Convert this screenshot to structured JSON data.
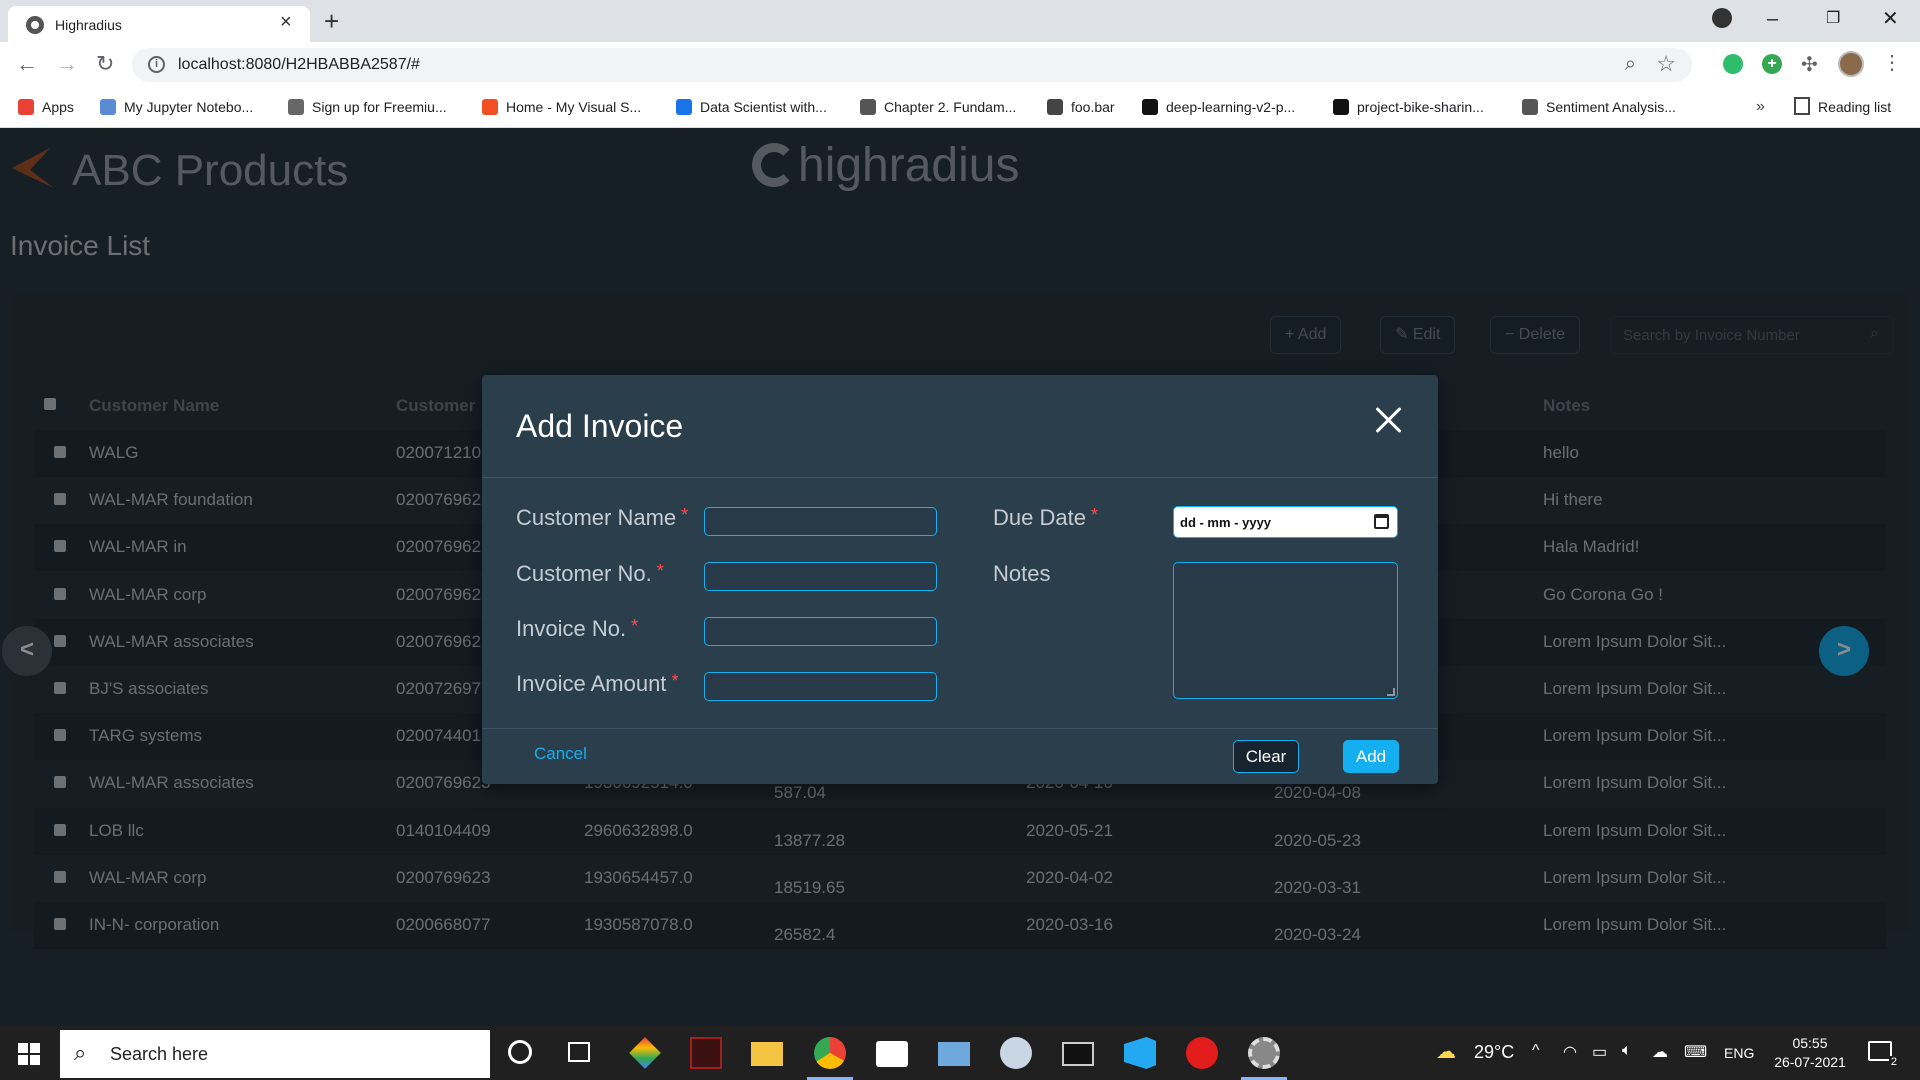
{
  "browser": {
    "tab_title": "Highradius",
    "url": "localhost:8080/H2HBABBA2587/#",
    "bookmarks": [
      {
        "label": "Apps",
        "color": "#e94235"
      },
      {
        "label": "My Jupyter Notebo...",
        "color": "#5b8bd3"
      },
      {
        "label": "Sign up for Freemiu...",
        "color": "#666666"
      },
      {
        "label": "Home - My Visual S...",
        "color": "#f25022"
      },
      {
        "label": "Data Scientist with...",
        "color": "#1a73e8"
      },
      {
        "label": "Chapter 2. Fundam...",
        "color": "#555555"
      },
      {
        "label": "foo.bar",
        "color": "#444444"
      },
      {
        "label": "deep-learning-v2-p...",
        "color": "#111111"
      },
      {
        "label": "project-bike-sharin...",
        "color": "#111111"
      },
      {
        "label": "Sentiment Analysis...",
        "color": "#555555"
      }
    ],
    "more_bookmarks": "»",
    "reading_list": "Reading list"
  },
  "app": {
    "brand": "ABC Products",
    "company_logo": "highradius",
    "page_title": "Invoice List",
    "actions": {
      "add": "Add",
      "edit": "Edit",
      "delete": "Delete"
    },
    "search_placeholder": "Search by Invoice Number",
    "columns": {
      "customer_name": "Customer Name",
      "customer_no": "Customer",
      "notes": "Notes"
    },
    "rows": [
      {
        "name": "WALG",
        "cust_no": "020071210",
        "invoice_no": "",
        "amount": "",
        "due_date": "",
        "clear_date": "",
        "notes": "hello"
      },
      {
        "name": "WAL-MAR foundation",
        "cust_no": "020076962",
        "invoice_no": "",
        "amount": "",
        "due_date": "",
        "clear_date": "",
        "notes": "Hi there"
      },
      {
        "name": "WAL-MAR in",
        "cust_no": "020076962",
        "invoice_no": "",
        "amount": "",
        "due_date": "",
        "clear_date": "",
        "notes": "Hala Madrid!"
      },
      {
        "name": "WAL-MAR corp",
        "cust_no": "020076962",
        "invoice_no": "",
        "amount": "",
        "due_date": "",
        "clear_date": "",
        "notes": "Go Corona Go !"
      },
      {
        "name": "WAL-MAR associates",
        "cust_no": "020076962",
        "invoice_no": "",
        "amount": "",
        "due_date": "",
        "clear_date": "",
        "notes": "Lorem Ipsum Dolor Sit..."
      },
      {
        "name": "BJ'S associates",
        "cust_no": "020072697",
        "invoice_no": "",
        "amount": "",
        "due_date": "",
        "clear_date": "",
        "notes": "Lorem Ipsum Dolor Sit..."
      },
      {
        "name": "TARG systems",
        "cust_no": "020074401",
        "invoice_no": "",
        "amount": "",
        "due_date": "",
        "clear_date": "",
        "notes": "Lorem Ipsum Dolor Sit..."
      },
      {
        "name": "WAL-MAR associates",
        "cust_no": "0200769623",
        "invoice_no": "1930692514.0",
        "amount": "587.04",
        "due_date": "2020-04-10",
        "clear_date": "2020-04-08",
        "notes": "Lorem Ipsum Dolor Sit..."
      },
      {
        "name": "LOB llc",
        "cust_no": "0140104409",
        "invoice_no": "2960632898.0",
        "amount": "13877.28",
        "due_date": "2020-05-21",
        "clear_date": "2020-05-23",
        "notes": "Lorem Ipsum Dolor Sit..."
      },
      {
        "name": "WAL-MAR corp",
        "cust_no": "0200769623",
        "invoice_no": "1930654457.0",
        "amount": "18519.65",
        "due_date": "2020-04-02",
        "clear_date": "2020-03-31",
        "notes": "Lorem Ipsum Dolor Sit..."
      },
      {
        "name": "IN-N- corporation",
        "cust_no": "0200668077",
        "invoice_no": "1930587078.0",
        "amount": "26582.4",
        "due_date": "2020-03-16",
        "clear_date": "2020-03-24",
        "notes": "Lorem Ipsum Dolor Sit..."
      }
    ],
    "prev_page": "<",
    "next_page": ">"
  },
  "modal": {
    "title": "Add Invoice",
    "fields": {
      "customer_name": {
        "label": "Customer Name",
        "value": ""
      },
      "customer_no": {
        "label": "Customer No.",
        "value": ""
      },
      "invoice_no": {
        "label": "Invoice No.",
        "value": ""
      },
      "invoice_amount": {
        "label": "Invoice Amount",
        "value": ""
      },
      "due_date": {
        "label": "Due Date",
        "placeholder": "dd - mm - yyyy"
      },
      "notes": {
        "label": "Notes",
        "value": ""
      }
    },
    "required_mark": "*",
    "cancel": "Cancel",
    "clear": "Clear",
    "add": "Add"
  },
  "taskbar": {
    "search_placeholder": "Search here",
    "weather": "29°C",
    "language": "ENG",
    "time": "05:55",
    "date": "26-07-2021",
    "notifications": "2"
  },
  "colors": {
    "accent": "#14aff1",
    "required": "#ff4d4d",
    "modal_bg": "#2a3e4c",
    "page_bg": "#2b3a45"
  }
}
